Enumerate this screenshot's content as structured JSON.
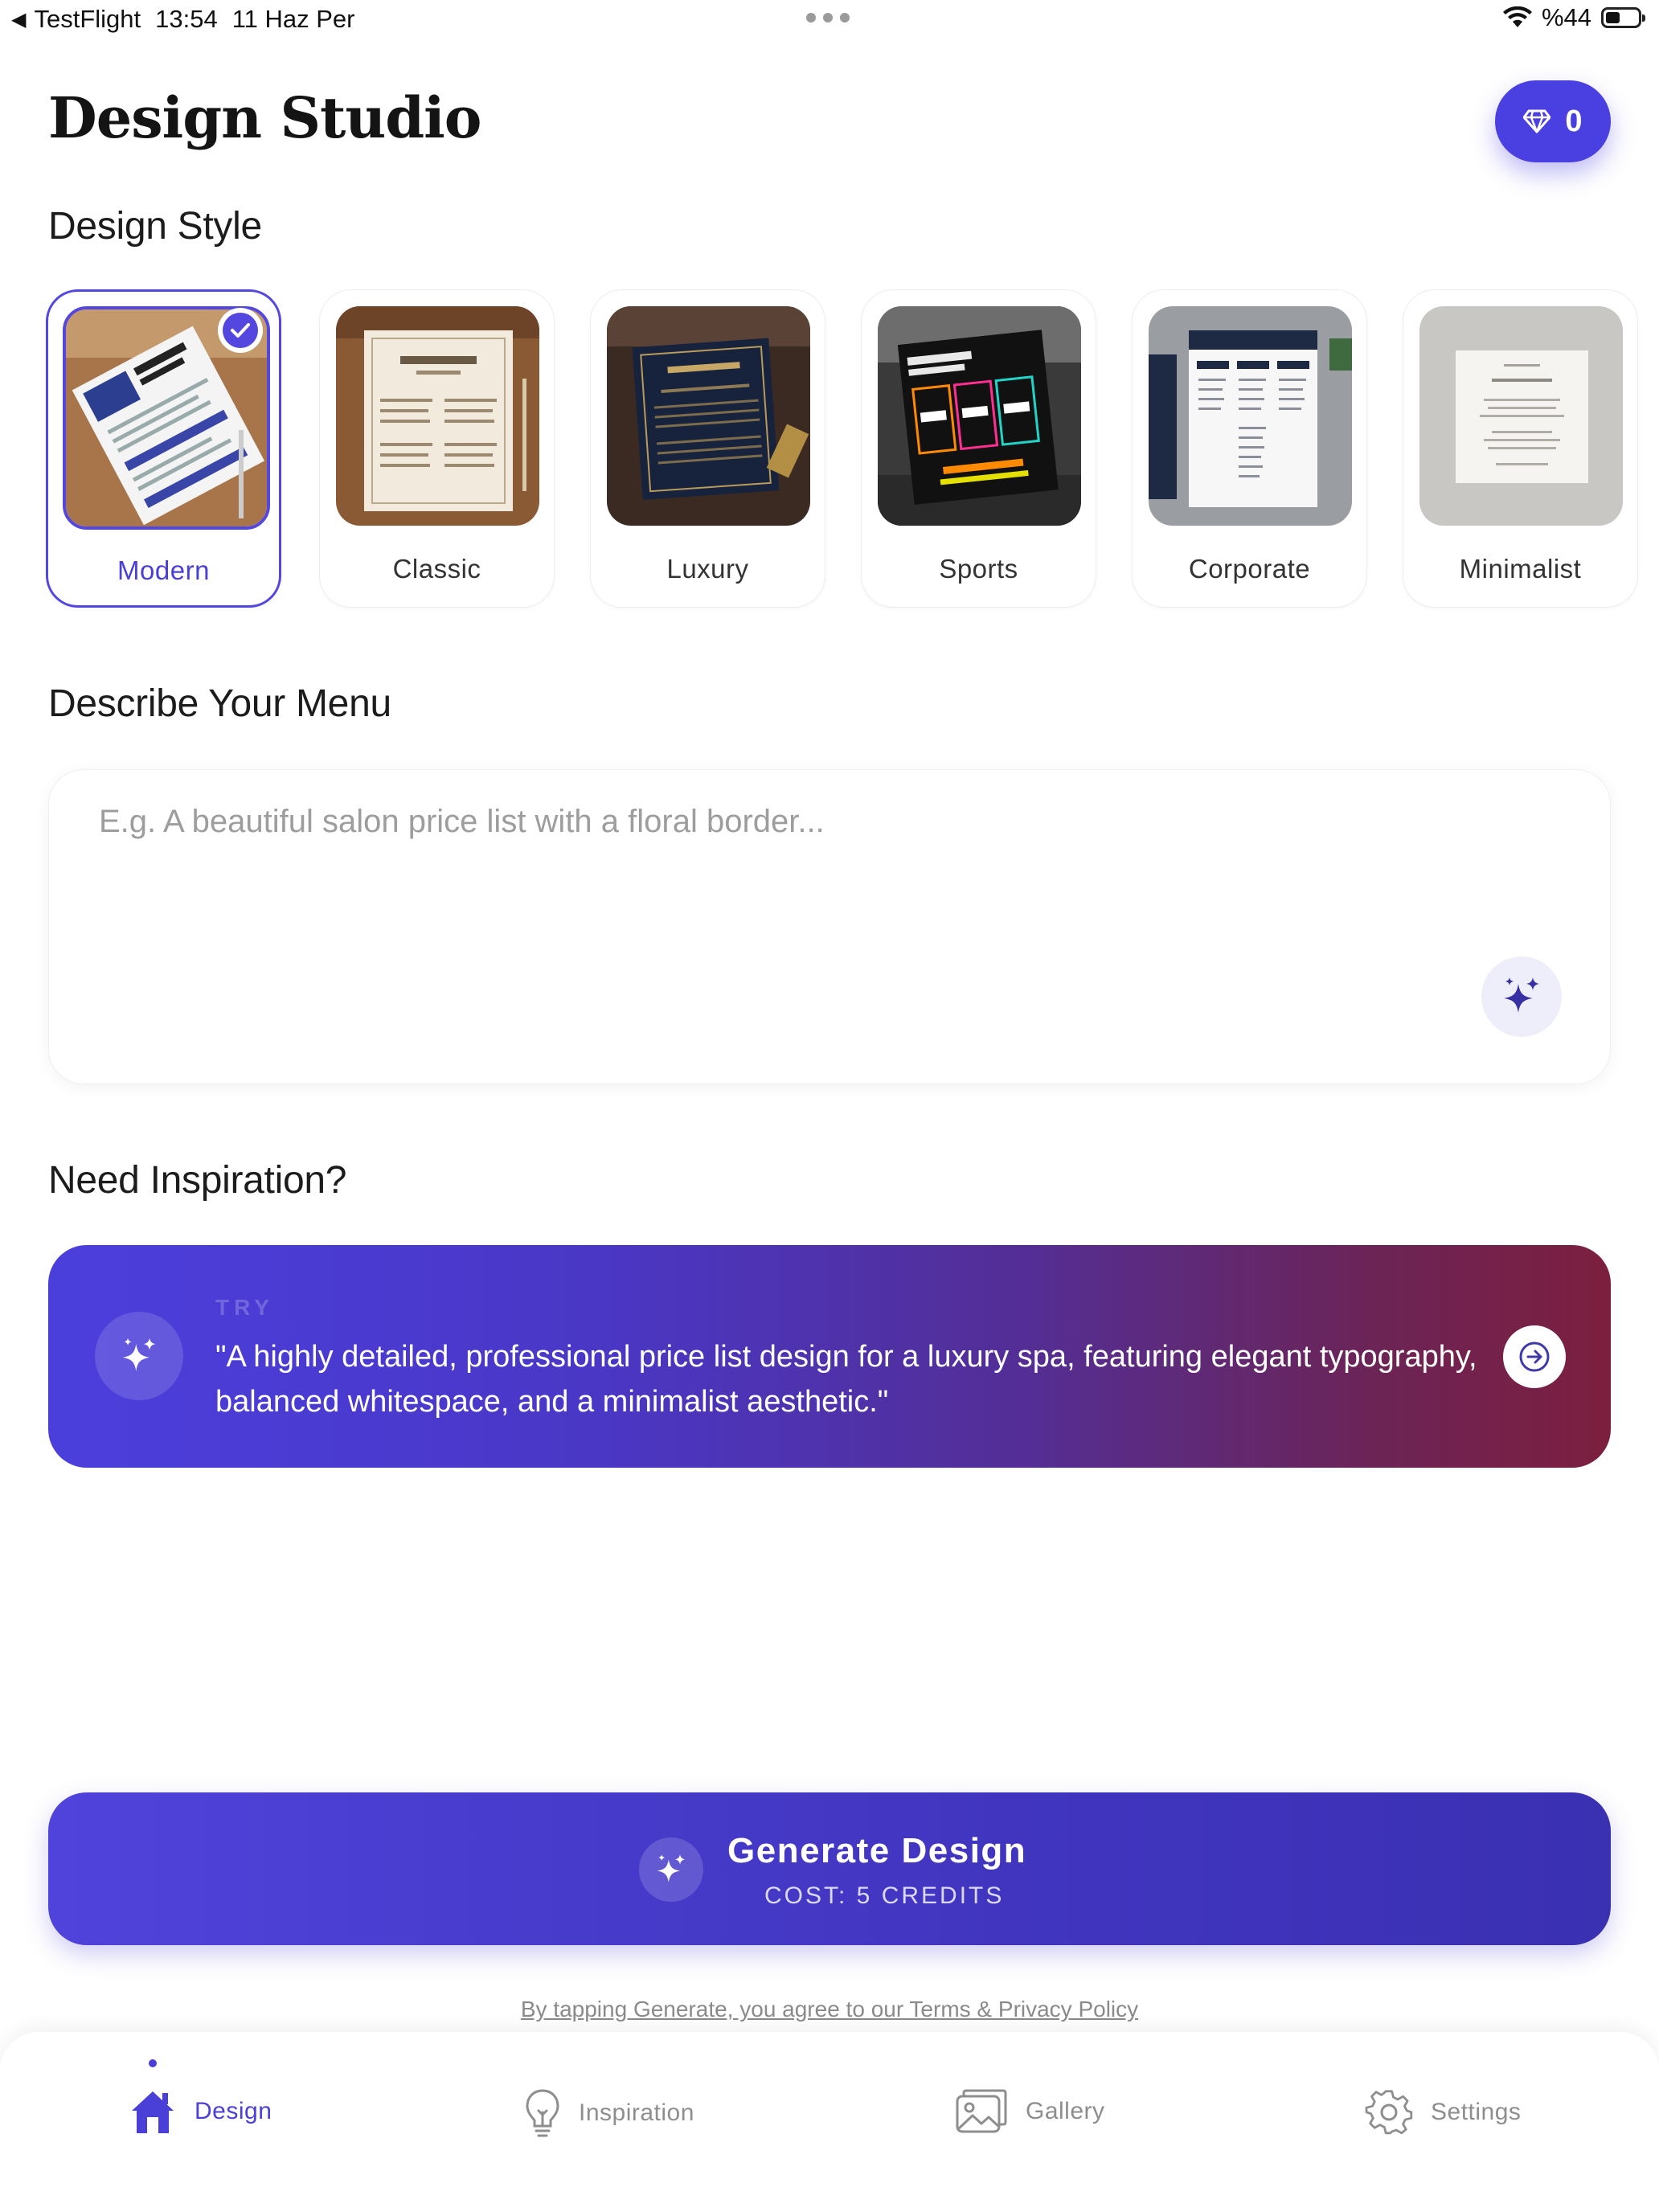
{
  "status_bar": {
    "back_app": "TestFlight",
    "time": "13:54",
    "date": "11 Haz Per",
    "battery": "%44",
    "battery_level": 0.44
  },
  "header": {
    "title": "Design Studio",
    "credits": "0"
  },
  "design_style": {
    "heading": "Design Style",
    "selected": "Modern",
    "styles": [
      {
        "label": "Modern"
      },
      {
        "label": "Classic"
      },
      {
        "label": "Luxury"
      },
      {
        "label": "Sports"
      },
      {
        "label": "Corporate"
      },
      {
        "label": "Minimalist"
      }
    ]
  },
  "describe": {
    "heading": "Describe Your Menu",
    "placeholder": "E.g. A beautiful salon price list with a floral border...",
    "value": ""
  },
  "inspiration": {
    "heading": "Need Inspiration?",
    "try_label": "TRY",
    "prompt": "\"A highly detailed, professional price list design for a luxury spa, featuring elegant typography, balanced whitespace, and a minimalist aesthetic.\""
  },
  "generate": {
    "label": "Generate Design",
    "cost": "COST: 5 CREDITS"
  },
  "terms": "By tapping Generate, you agree to our Terms & Privacy Policy",
  "tabs": [
    {
      "label": "Design",
      "active": true
    },
    {
      "label": "Inspiration",
      "active": false
    },
    {
      "label": "Gallery",
      "active": false
    },
    {
      "label": "Settings",
      "active": false
    }
  ],
  "colors": {
    "accent": "#4a3fd6",
    "banner_start": "#4b3fdc",
    "banner_end": "#7c1f3e"
  }
}
